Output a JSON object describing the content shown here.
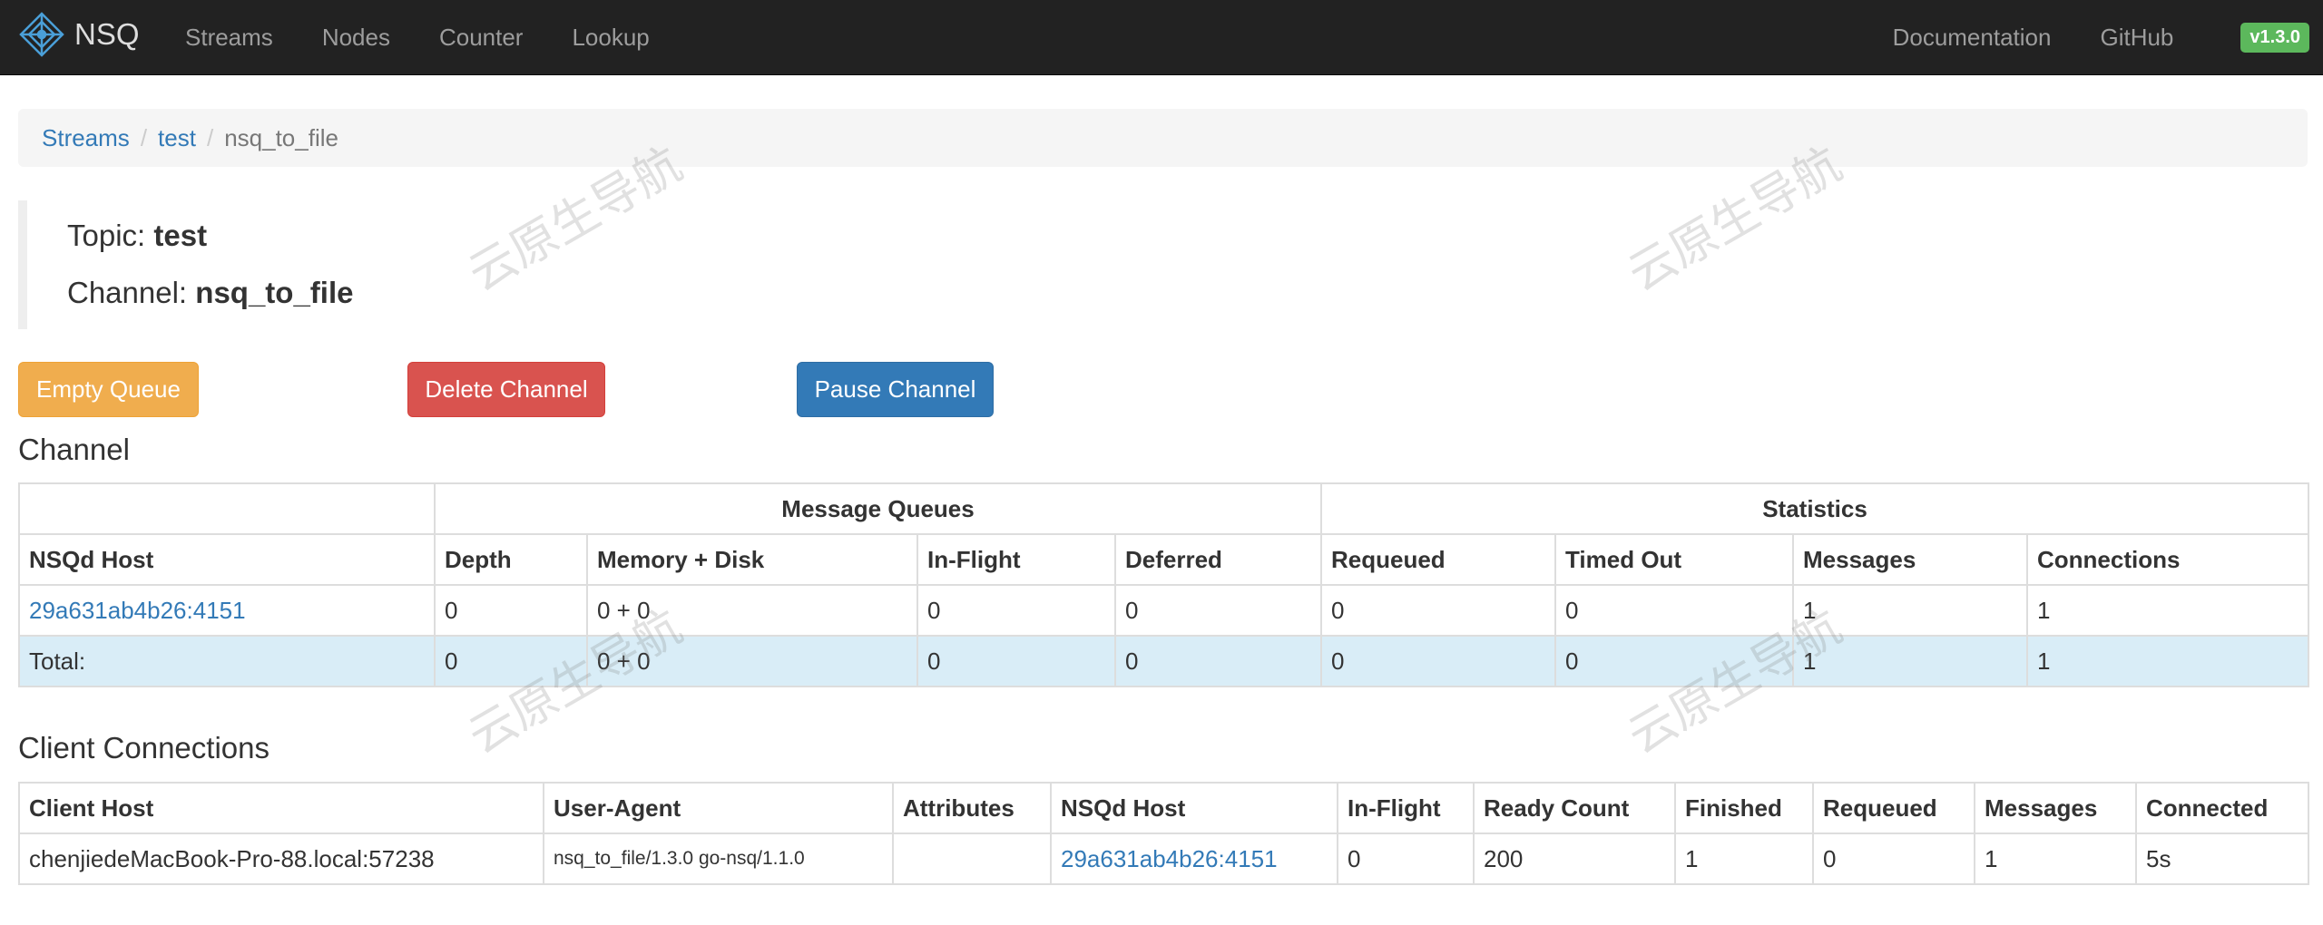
{
  "navbar": {
    "brand": "NSQ",
    "links": [
      "Streams",
      "Nodes",
      "Counter",
      "Lookup"
    ],
    "right_links": [
      "Documentation",
      "GitHub"
    ],
    "version": "v1.3.0"
  },
  "breadcrumb": {
    "items": [
      "Streams",
      "test"
    ],
    "active": "nsq_to_file"
  },
  "header": {
    "topic_label": "Topic:",
    "topic": "test",
    "channel_label": "Channel:",
    "channel": "nsq_to_file"
  },
  "actions": {
    "empty_queue": "Empty Queue",
    "delete_channel": "Delete Channel",
    "pause_channel": "Pause Channel"
  },
  "channel": {
    "title": "Channel",
    "group_headers": [
      "Message Queues",
      "Statistics"
    ],
    "columns": [
      "NSQd Host",
      "Depth",
      "Memory + Disk",
      "In-Flight",
      "Deferred",
      "Requeued",
      "Timed Out",
      "Messages",
      "Connections"
    ],
    "rows": [
      [
        "29a631ab4b26:4151",
        "0",
        "0 + 0",
        "0",
        "0",
        "0",
        "0",
        "1",
        "1"
      ]
    ],
    "total": [
      "Total:",
      "0",
      "0 + 0",
      "0",
      "0",
      "0",
      "0",
      "1",
      "1"
    ]
  },
  "clients": {
    "title": "Client Connections",
    "columns": [
      "Client Host",
      "User-Agent",
      "Attributes",
      "NSQd Host",
      "In-Flight",
      "Ready Count",
      "Finished",
      "Requeued",
      "Messages",
      "Connected"
    ],
    "rows": [
      [
        "chenjiedeMacBook-Pro-88.local:57238",
        "nsq_to_file/1.3.0 go-nsq/1.1.0",
        "",
        "29a631ab4b26:4151",
        "0",
        "200",
        "1",
        "0",
        "1",
        "5s"
      ]
    ]
  },
  "watermark": "云原生导航",
  "colors": {
    "navbar": "#222222",
    "link": "#337ab7",
    "warning": "#f0ad4e",
    "danger": "#d9534f",
    "primary": "#337ab7",
    "badge": "#5cb85c",
    "total_row": "#d9edf7"
  }
}
